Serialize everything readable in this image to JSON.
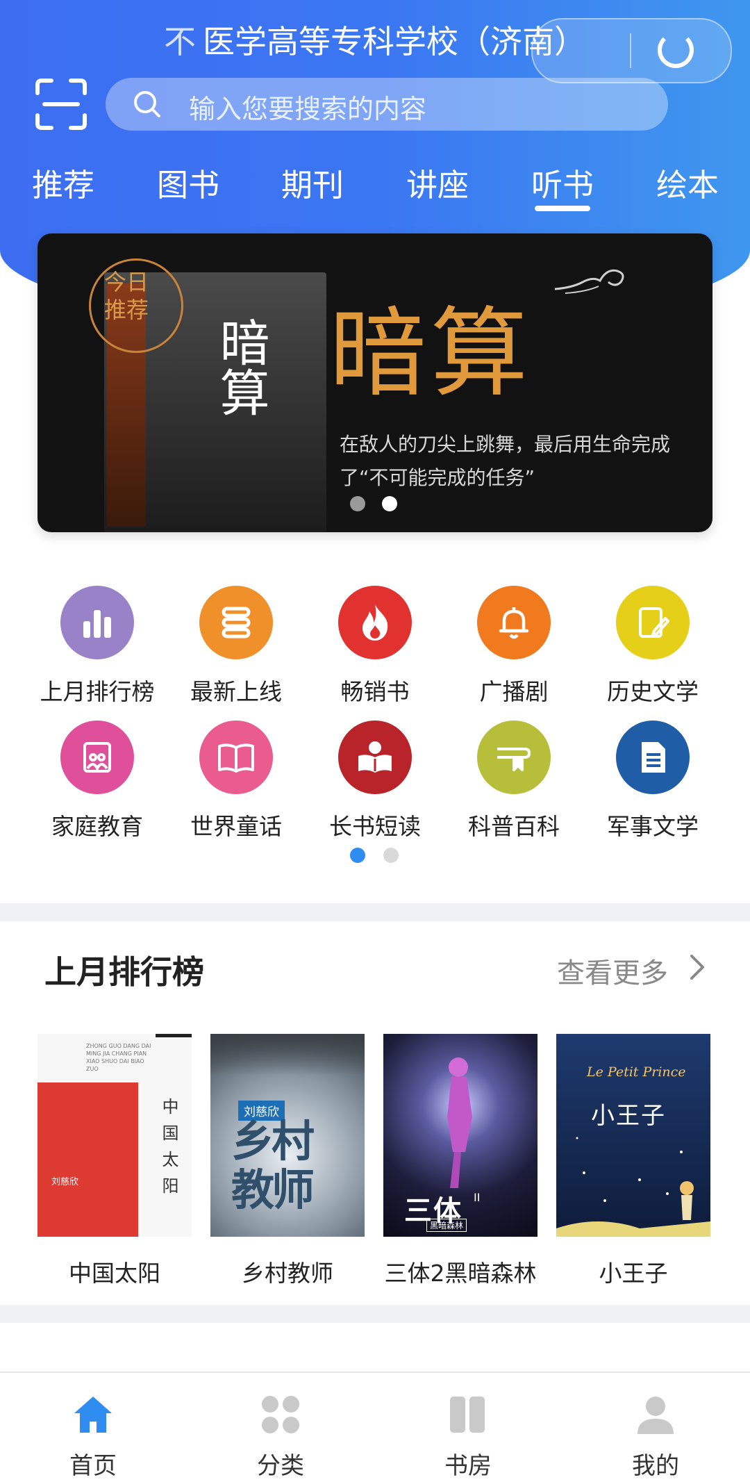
{
  "header": {
    "title_prefix": "不",
    "title": "医学高等专科学校（济南）",
    "search_placeholder": "输入您要搜索的内容",
    "tabs": [
      "推荐",
      "图书",
      "期刊",
      "讲座",
      "听书",
      "绘本"
    ],
    "active_tab": "听书"
  },
  "banner": {
    "badge": "今日推荐",
    "cover_title": "暗算",
    "title": "暗算",
    "desc_line1": "在敌人的刀尖上跳舞，最后用生命完成",
    "desc_line2": "了“不可能完成的任务”",
    "active_dot": 2
  },
  "categories": [
    {
      "label": "上月排行榜",
      "icon": "bar-chart-icon",
      "color": "#9a82c9"
    },
    {
      "label": "最新上线",
      "icon": "stack-icon",
      "color": "#f0902a"
    },
    {
      "label": "畅销书",
      "icon": "flame-icon",
      "color": "#e1322f"
    },
    {
      "label": "广播剧",
      "icon": "bell-icon",
      "color": "#f27a1e"
    },
    {
      "label": "历史文学",
      "icon": "notebook-pen-icon",
      "color": "#e6cf19"
    },
    {
      "label": "家庭教育",
      "icon": "family-book-icon",
      "color": "#e0509a"
    },
    {
      "label": "世界童话",
      "icon": "open-book-icon",
      "color": "#ea5b8e"
    },
    {
      "label": "长书短读",
      "icon": "reader-icon",
      "color": "#b8242a"
    },
    {
      "label": "科普百科",
      "icon": "bookmark-book-icon",
      "color": "#b7bf3a"
    },
    {
      "label": "军事文学",
      "icon": "document-icon",
      "color": "#1f5ea6"
    }
  ],
  "ranking": {
    "title": "上月排行榜",
    "more": "查看更多",
    "books": [
      {
        "title": "中国太阳",
        "cover_text": "中国太阳",
        "author": "刘慈欣",
        "roman": "ZHONG GUO DANG DAI MING JIA CHANG PIAN XIAO SHUO DAI BIAO ZUO"
      },
      {
        "title": "乡村教师",
        "cover_text": "乡村教师",
        "author": "刘慈欣"
      },
      {
        "title": "三体2黑暗森林",
        "cover_text": "三体",
        "cover_sub": "黑暗森林",
        "numeral": "II"
      },
      {
        "title": "小王子",
        "cover_text": "小王子",
        "cover_en": "Le Petit Prince"
      }
    ]
  },
  "bottom_nav": [
    {
      "label": "首页",
      "icon": "home-icon",
      "active": true
    },
    {
      "label": "分类",
      "icon": "grid-icon",
      "active": false
    },
    {
      "label": "书房",
      "icon": "bookshelf-icon",
      "active": false
    },
    {
      "label": "我的",
      "icon": "user-icon",
      "active": false
    }
  ],
  "colors": {
    "accent": "#3d6ef2",
    "nav_active": "#2f8cf0",
    "nav_inactive": "#c9c9c9"
  }
}
